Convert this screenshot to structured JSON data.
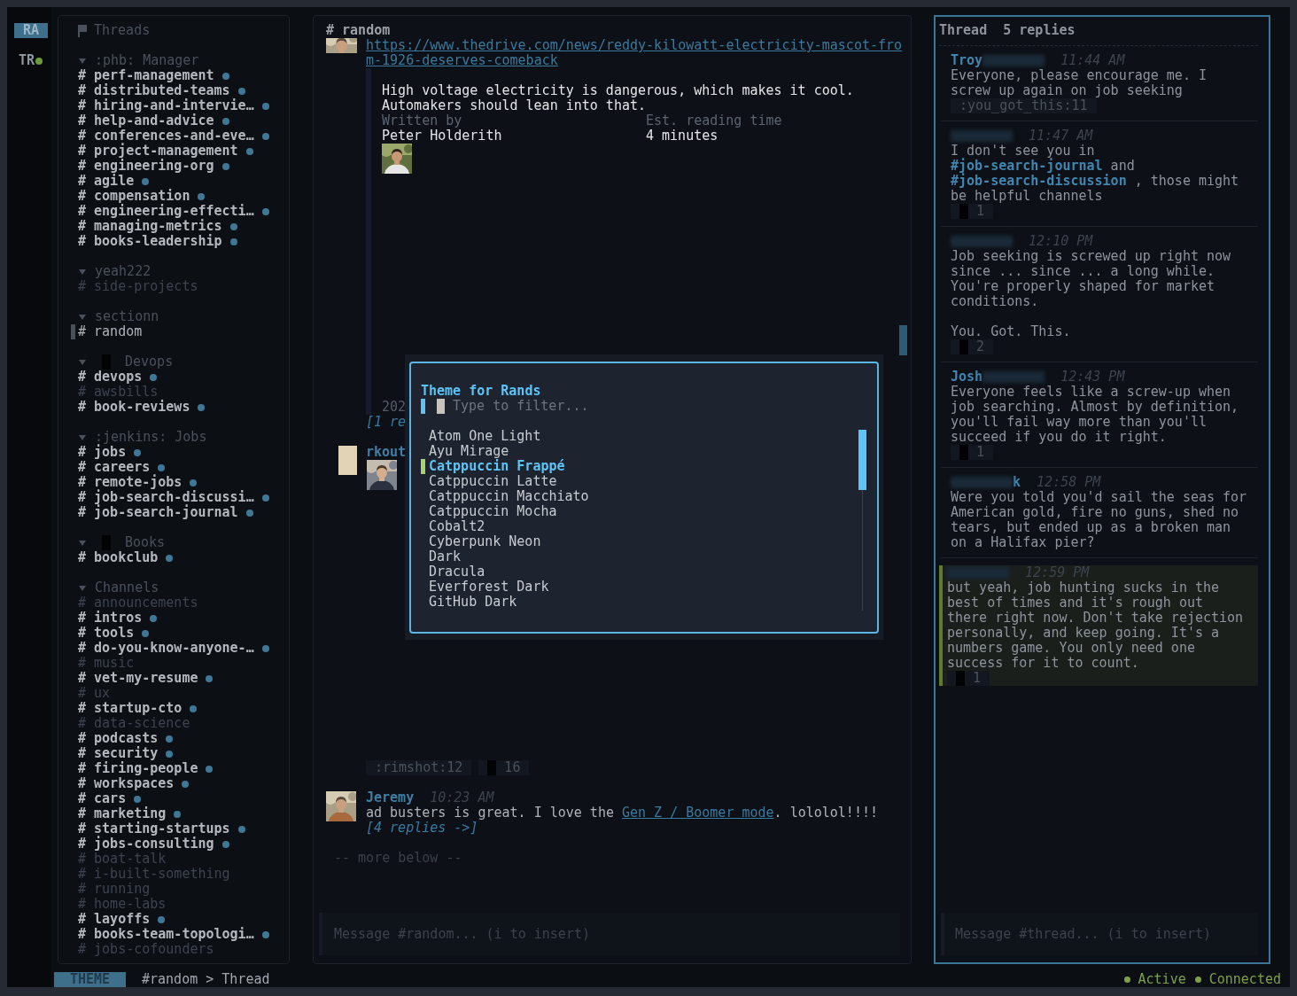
{
  "rail": {
    "workspaces": [
      {
        "label": "RA",
        "selected": true,
        "online": false
      },
      {
        "label": "TR",
        "selected": false,
        "online": true
      }
    ]
  },
  "sidebar": {
    "title": "Threads",
    "sections": [
      {
        "label": ":phb: Manager",
        "expanded": true,
        "emoji": false,
        "channels": [
          {
            "label": "# perf-management",
            "unread": true,
            "selected": false
          },
          {
            "label": "# distributed-teams",
            "unread": true,
            "selected": false
          },
          {
            "label": "# hiring-and-intervie…",
            "unread": true,
            "selected": false
          },
          {
            "label": "# help-and-advice",
            "unread": true,
            "selected": false
          },
          {
            "label": "# conferences-and-eve…",
            "unread": true,
            "selected": false
          },
          {
            "label": "# project-management",
            "unread": true,
            "selected": false
          },
          {
            "label": "# engineering-org",
            "unread": true,
            "selected": false
          },
          {
            "label": "# agile",
            "unread": true,
            "selected": false
          },
          {
            "label": "# compensation",
            "unread": true,
            "selected": false
          },
          {
            "label": "# engineering-effecti…",
            "unread": true,
            "selected": false
          },
          {
            "label": "# managing-metrics",
            "unread": true,
            "selected": false
          },
          {
            "label": "# books-leadership",
            "unread": true,
            "selected": false
          }
        ]
      },
      {
        "label": "yeah222",
        "expanded": true,
        "emoji": false,
        "channels": [
          {
            "label": "# side-projects",
            "unread": false,
            "selected": false
          }
        ]
      },
      {
        "label": "sectionn",
        "expanded": true,
        "emoji": false,
        "channels": [
          {
            "label": "# random",
            "unread": false,
            "selected": true
          }
        ]
      },
      {
        "label": "Devops",
        "expanded": true,
        "emoji": true,
        "channels": [
          {
            "label": "# devops",
            "unread": true,
            "selected": false
          },
          {
            "label": "# awsbills",
            "unread": false,
            "selected": false
          },
          {
            "label": "# book-reviews",
            "unread": true,
            "selected": false
          }
        ]
      },
      {
        "label": ":jenkins: Jobs",
        "expanded": true,
        "emoji": false,
        "channels": [
          {
            "label": "# jobs",
            "unread": true,
            "selected": false
          },
          {
            "label": "# careers",
            "unread": true,
            "selected": false
          },
          {
            "label": "# remote-jobs",
            "unread": true,
            "selected": false
          },
          {
            "label": "# job-search-discussi…",
            "unread": true,
            "selected": false
          },
          {
            "label": "# job-search-journal",
            "unread": true,
            "selected": false
          }
        ]
      },
      {
        "label": "Books",
        "expanded": true,
        "emoji": true,
        "channels": [
          {
            "label": "# bookclub",
            "unread": true,
            "selected": false
          }
        ]
      },
      {
        "label": "Channels",
        "expanded": true,
        "emoji": false,
        "channels": [
          {
            "label": "# announcements",
            "unread": false,
            "selected": false
          },
          {
            "label": "# intros",
            "unread": true,
            "selected": false
          },
          {
            "label": "# tools",
            "unread": true,
            "selected": false
          },
          {
            "label": "# do-you-know-anyone-…",
            "unread": true,
            "selected": false
          },
          {
            "label": "# music",
            "unread": false,
            "selected": false
          },
          {
            "label": "# vet-my-resume",
            "unread": true,
            "selected": false
          },
          {
            "label": "# ux",
            "unread": false,
            "selected": false
          },
          {
            "label": "# startup-cto",
            "unread": true,
            "selected": false
          },
          {
            "label": "# data-science",
            "unread": false,
            "selected": false
          },
          {
            "label": "# podcasts",
            "unread": true,
            "selected": false
          },
          {
            "label": "# security",
            "unread": true,
            "selected": false
          },
          {
            "label": "# firing-people",
            "unread": true,
            "selected": false
          },
          {
            "label": "# workspaces",
            "unread": true,
            "selected": false
          },
          {
            "label": "# cars",
            "unread": true,
            "selected": false
          },
          {
            "label": "# marketing",
            "unread": true,
            "selected": false
          },
          {
            "label": "# starting-startups",
            "unread": true,
            "selected": false
          },
          {
            "label": "# jobs-consulting",
            "unread": true,
            "selected": false
          },
          {
            "label": "# boat-talk",
            "unread": false,
            "selected": false
          },
          {
            "label": "# i-built-something",
            "unread": false,
            "selected": false
          },
          {
            "label": "# running",
            "unread": false,
            "selected": false
          },
          {
            "label": "# home-labs",
            "unread": false,
            "selected": false
          },
          {
            "label": "# layoffs",
            "unread": true,
            "selected": false
          },
          {
            "label": "# books-team-topologi…",
            "unread": true,
            "selected": false
          },
          {
            "label": "# jobs-cofounders",
            "unread": false,
            "selected": false
          }
        ]
      }
    ]
  },
  "channel": {
    "title": "# random",
    "link": "https://www.thedrive.com/news/reddy-kilowatt-electricity-mascot-from-1926-deserves-comeback",
    "preview": {
      "description": "High voltage electricity is dangerous, which makes it cool. Automakers should lean into that.",
      "fields": [
        {
          "label": "Written by",
          "value": "Peter Holderith"
        },
        {
          "label": "Est. reading time",
          "value": "4 minutes"
        }
      ],
      "date": "202"
    },
    "replies": "[1 re",
    "second_author": "rkout",
    "reactions": [
      {
        "label": ":rimshot:12",
        "emoji": false
      },
      {
        "label": "16",
        "emoji": true
      }
    ],
    "messages": [
      {
        "author": "Jeremy",
        "time": "10:23 AM",
        "before": "ad busters is great. I love the ",
        "link": "Gen Z / Boomer mode",
        "after": ". lololol!!!!",
        "replies": "[4 replies ->]"
      }
    ],
    "more": "-- more below --",
    "composer": {
      "placeholder": "Message #random... (i to insert)"
    }
  },
  "theme_picker": {
    "title": "Theme for Rands",
    "filter": {
      "placeholder": "Type to filter..."
    },
    "items": [
      {
        "label": "Atom One Light",
        "selected": false
      },
      {
        "label": "Ayu Mirage",
        "selected": false
      },
      {
        "label": "Catppuccin Frappé",
        "selected": true
      },
      {
        "label": "Catppuccin Latte",
        "selected": false
      },
      {
        "label": "Catppuccin Macchiato",
        "selected": false
      },
      {
        "label": "Catppuccin Mocha",
        "selected": false
      },
      {
        "label": "Cobalt2",
        "selected": false
      },
      {
        "label": "Cyberpunk Neon",
        "selected": false
      },
      {
        "label": "Dark",
        "selected": false
      },
      {
        "label": "Dracula",
        "selected": false
      },
      {
        "label": "Everforest Dark",
        "selected": false
      },
      {
        "label": "GitHub Dark",
        "selected": false
      }
    ]
  },
  "thread": {
    "title": "Thread",
    "count": "5 replies",
    "messages": [
      {
        "author": [
          {
            "kind": "text",
            "text": "Troy"
          },
          {
            "kind": "redacted"
          }
        ],
        "time": "11:44 AM",
        "text": "Everyone, please encourage me. I screw up again on job seeking",
        "reactions": [
          {
            "label": ":you_got_this:11",
            "emoji": false
          }
        ],
        "highlighted": false
      },
      {
        "author": [
          {
            "kind": "redacted"
          }
        ],
        "time": "11:47 AM",
        "text": "I don't see you in **#job-search-journal** and **#job-search-discussion** , those might be helpful channels",
        "reactions": [
          {
            "label": "1",
            "emoji": true
          }
        ],
        "highlighted": false
      },
      {
        "author": [
          {
            "kind": "redacted"
          }
        ],
        "time": "12:10 PM",
        "text": "Job seeking is screwed up right now since ... since ... a long while. You're properly shaped for market conditions.\n\nYou. Got. This.",
        "reactions": [
          {
            "label": "2",
            "emoji": true
          }
        ],
        "highlighted": false
      },
      {
        "author": [
          {
            "kind": "text",
            "text": "Josh"
          },
          {
            "kind": "redacted"
          }
        ],
        "time": "12:43 PM",
        "text": "Everyone feels like a screw-up when job searching. Almost by definition, you'll fail way more than you'll succeed if you do it right.",
        "reactions": [
          {
            "label": "1",
            "emoji": true
          }
        ],
        "highlighted": false
      },
      {
        "author": [
          {
            "kind": "redacted"
          },
          {
            "kind": "text",
            "text": "k"
          }
        ],
        "time": "12:58 PM",
        "text": "Were you told you'd sail the seas for American gold, fire no guns, shed no tears, but ended up as a broken man on a Halifax pier?",
        "highlighted": false
      },
      {
        "author": [
          {
            "kind": "redacted"
          }
        ],
        "time": "12:59 PM",
        "text": "but yeah, job hunting sucks in the best of times and it's rough out there right now. Don't take rejection personally, and keep going. It's a numbers game. You only need one success for it to count.",
        "reactions": [
          {
            "label": "1",
            "emoji": true
          }
        ],
        "highlighted": true
      }
    ],
    "composer": {
      "placeholder": "Message #thread... (i to insert)"
    }
  },
  "status_bar": {
    "mode": "THEME",
    "breadcrumb": "#random > Thread",
    "statuses": [
      {
        "label": "Active"
      },
      {
        "label": "Connected"
      }
    ]
  }
}
